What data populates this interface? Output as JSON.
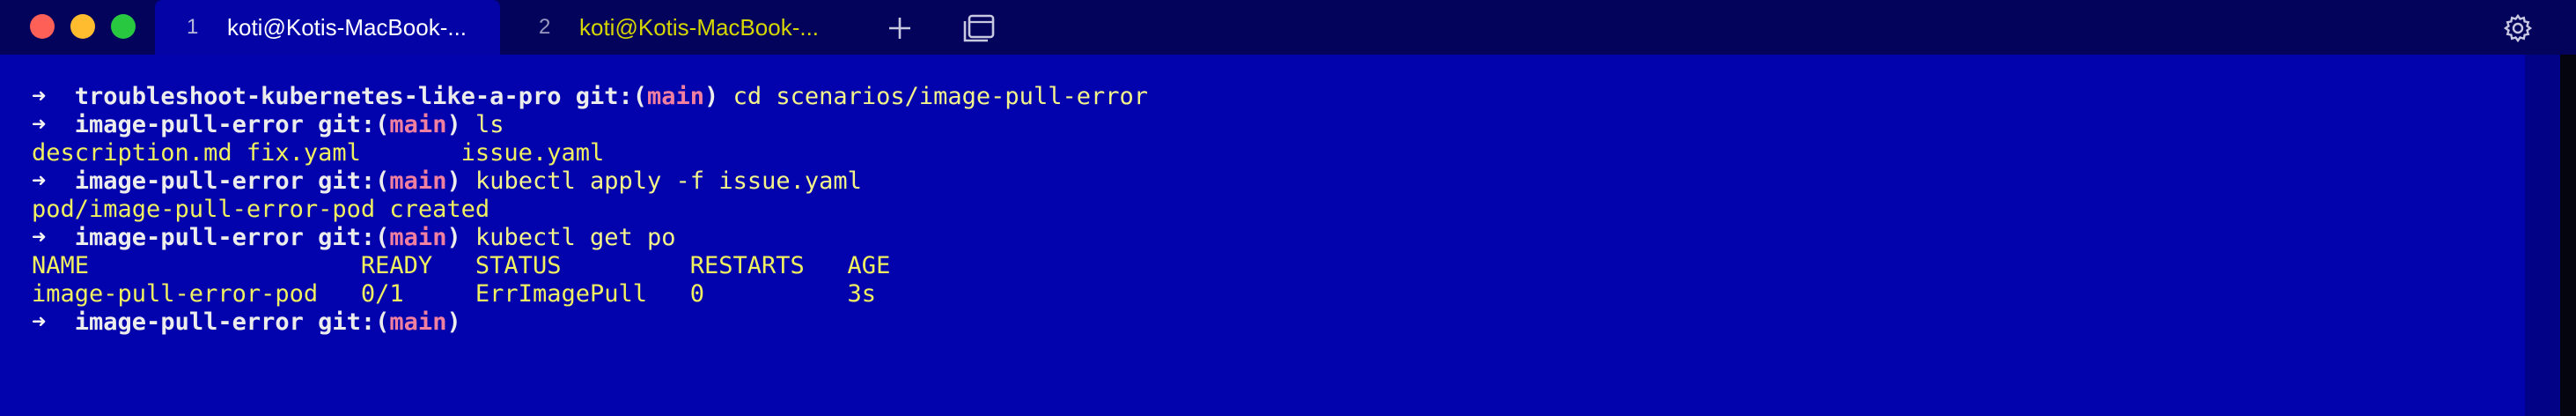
{
  "window": {
    "controls": [
      "close",
      "minimize",
      "maximize"
    ]
  },
  "tabs": [
    {
      "number": "1",
      "title": "koti@Kotis-MacBook-...",
      "active": true
    },
    {
      "number": "2",
      "title": "koti@Kotis-MacBook-...",
      "active": false
    }
  ],
  "toolbar": {
    "new_tab_icon": "plus-icon",
    "overview_icon": "tab-overview-icon",
    "settings_icon": "gear-icon"
  },
  "terminal": {
    "prompt_arrow": "➜",
    "git_label": "git:(",
    "git_close": ")",
    "lines": [
      {
        "type": "prompt",
        "dir": "troubleshoot-kubernetes-like-a-pro",
        "branch": "main",
        "command": "cd scenarios/image-pull-error"
      },
      {
        "type": "prompt",
        "dir": "image-pull-error",
        "branch": "main",
        "command": "ls"
      },
      {
        "type": "output",
        "text": "description.md fix.yaml       issue.yaml"
      },
      {
        "type": "prompt",
        "dir": "image-pull-error",
        "branch": "main",
        "command": "kubectl apply -f issue.yaml"
      },
      {
        "type": "output",
        "text": "pod/image-pull-error-pod created"
      },
      {
        "type": "prompt",
        "dir": "image-pull-error",
        "branch": "main",
        "command": "kubectl get po"
      },
      {
        "type": "output",
        "text": "NAME                   READY   STATUS         RESTARTS   AGE"
      },
      {
        "type": "output",
        "text": "image-pull-error-pod   0/1     ErrImagePull   0          3s"
      },
      {
        "type": "prompt",
        "dir": "image-pull-error",
        "branch": "main",
        "command": ""
      }
    ]
  },
  "colors": {
    "background": "#0303ad",
    "tabbar": "#03035c",
    "output_text": "#f0f060",
    "branch": "#f07fa0",
    "close": "#fe5f57",
    "minimize": "#febc2e",
    "maximize": "#28c840"
  }
}
